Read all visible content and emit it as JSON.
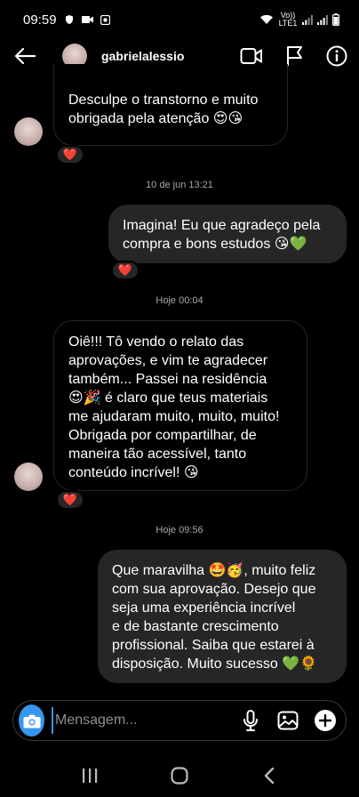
{
  "status_bar": {
    "time": "09:59",
    "network": "Vo)) LTE1"
  },
  "header": {
    "username": "gabrielalessio",
    "icons": [
      "back-arrow-icon",
      "video-call-icon",
      "flag-icon",
      "info-icon"
    ]
  },
  "messages": [
    {
      "id": 1,
      "direction": "incoming",
      "lines": [
        "Desculpe o transtorno e muito",
        "obrigada pela atenção 😍😘"
      ],
      "reaction": "❤️"
    },
    {
      "id": 2,
      "direction": "outgoing",
      "lines": [
        "Imagina! Eu que agradeço pela",
        "compra e bons estudos 😘💚"
      ],
      "reaction": "❤️"
    },
    {
      "id": 3,
      "direction": "incoming",
      "lines": [
        "Oiê!!! Tô vendo o relato das",
        "aprovações, e vim te agradecer",
        "também... Passei na residência",
        "😍🎉 é claro que teus materiais",
        "me ajudaram muito, muito, muito!",
        "Obrigada por compartilhar, de",
        "maneira tão acessível, tanto",
        "conteúdo incrível! 😘"
      ],
      "reaction": "❤️"
    },
    {
      "id": 4,
      "direction": "outgoing",
      "lines": [
        "Que maravilha 🤩🥳, muito feliz",
        "com sua aprovação. Desejo que",
        "seja uma experiência incrível",
        "e de bastante crescimento",
        "profissional. Saiba que estarei à",
        "disposição. Muito sucesso 💚🌻"
      ]
    }
  ],
  "timestamps": [
    "10 de jun 13:21",
    "Hoje 00:04",
    "Hoje 09:56"
  ],
  "composer": {
    "placeholder": "Mensagem...",
    "icons": [
      "camera-icon",
      "microphone-icon",
      "gallery-icon",
      "add-icon"
    ]
  },
  "navbar": {
    "icons": [
      "recent-apps-icon",
      "home-icon",
      "back-icon"
    ]
  },
  "colors": {
    "background": "#000000",
    "bubble_out": "#262626",
    "bubble_in_border": "#262626",
    "accent": "#3797f0",
    "timestamp": "#a8a8a8"
  }
}
